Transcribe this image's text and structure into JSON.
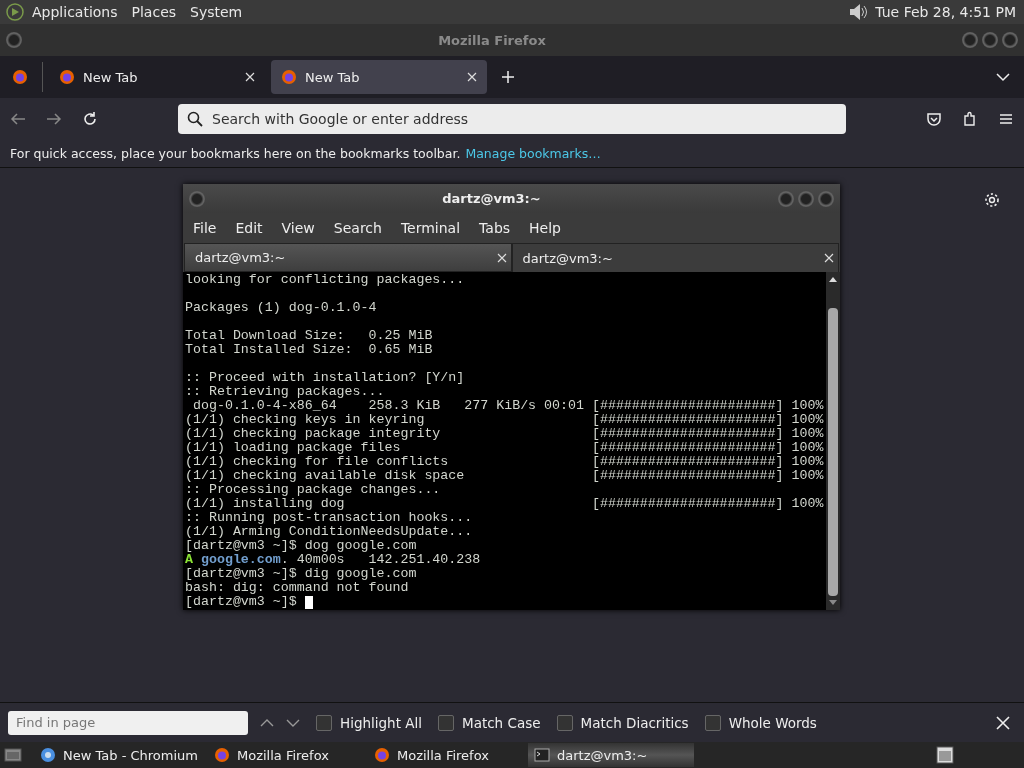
{
  "top_panel": {
    "menus": [
      "Applications",
      "Places",
      "System"
    ],
    "clock": "Tue Feb 28,  4:51 PM"
  },
  "window": {
    "title": "Mozilla Firefox"
  },
  "tabs": [
    {
      "label": "New Tab",
      "selected": false
    },
    {
      "label": "New Tab",
      "selected": true
    }
  ],
  "address_bar": {
    "placeholder": "Search with Google or enter address"
  },
  "bookmarks_bar": {
    "text": "For quick access, place your bookmarks here on the bookmarks toolbar.",
    "link": "Manage bookmarks…"
  },
  "terminal": {
    "title": "dartz@vm3:~",
    "menus": [
      "File",
      "Edit",
      "View",
      "Search",
      "Terminal",
      "Tabs",
      "Help"
    ],
    "tabs": [
      {
        "label": "dartz@vm3:~",
        "selected": false
      },
      {
        "label": "dartz@vm3:~",
        "selected": true
      }
    ],
    "lines": [
      {
        "text": "looking for conflicting packages..."
      },
      {
        "text": "Packages (1) dog-0.1.0-4",
        "blank_before": true
      },
      {
        "text": "Total Download Size:   0.25 MiB",
        "blank_before": true
      },
      {
        "text": "Total Installed Size:  0.65 MiB"
      },
      {
        "text": ":: Proceed with installation? [Y/n]",
        "blank_before": true
      },
      {
        "text": ":: Retrieving packages..."
      },
      {
        "text": " dog-0.1.0-4-x86_64    258.3 KiB   277 KiB/s 00:01 [######################] 100%"
      },
      {
        "text": "(1/1) checking keys in keyring                     [######################] 100%"
      },
      {
        "text": "(1/1) checking package integrity                   [######################] 100%"
      },
      {
        "text": "(1/1) loading package files                        [######################] 100%"
      },
      {
        "text": "(1/1) checking for file conflicts                  [######################] 100%"
      },
      {
        "text": "(1/1) checking available disk space                [######################] 100%"
      },
      {
        "text": ":: Processing package changes..."
      },
      {
        "text": "(1/1) installing dog                               [######################] 100%"
      },
      {
        "text": ":: Running post-transaction hooks..."
      },
      {
        "text": "(1/1) Arming ConditionNeedsUpdate..."
      },
      {
        "text": "[dartz@vm3 ~]$ dog google.com"
      },
      {
        "segments": [
          {
            "text": "A",
            "color": "#8ae234"
          },
          {
            "text": " google.com",
            "color": "#729fcf"
          },
          {
            "text": ". 40m00s   142.251.40.238",
            "color": "#d3d7cf"
          }
        ]
      },
      {
        "text": "[dartz@vm3 ~]$ dig google.com"
      },
      {
        "text": "bash: dig: command not found"
      },
      {
        "text": "[dartz@vm3 ~]$ ",
        "cursor": true
      }
    ]
  },
  "find_bar": {
    "placeholder": "Find in page",
    "options": [
      {
        "label": "Highlight All",
        "checked": false
      },
      {
        "label": "Match Case",
        "checked": false
      },
      {
        "label": "Match Diacritics",
        "checked": false
      },
      {
        "label": "Whole Words",
        "checked": false
      }
    ]
  },
  "taskbar": {
    "items": [
      {
        "label": "New Tab - Chromium",
        "kind": "chromium",
        "selected": false
      },
      {
        "label": "Mozilla Firefox",
        "kind": "firefox",
        "selected": false
      },
      {
        "label": "Mozilla Firefox",
        "kind": "firefox",
        "selected": false
      },
      {
        "label": "dartz@vm3:~",
        "kind": "terminal",
        "selected": true
      }
    ]
  }
}
